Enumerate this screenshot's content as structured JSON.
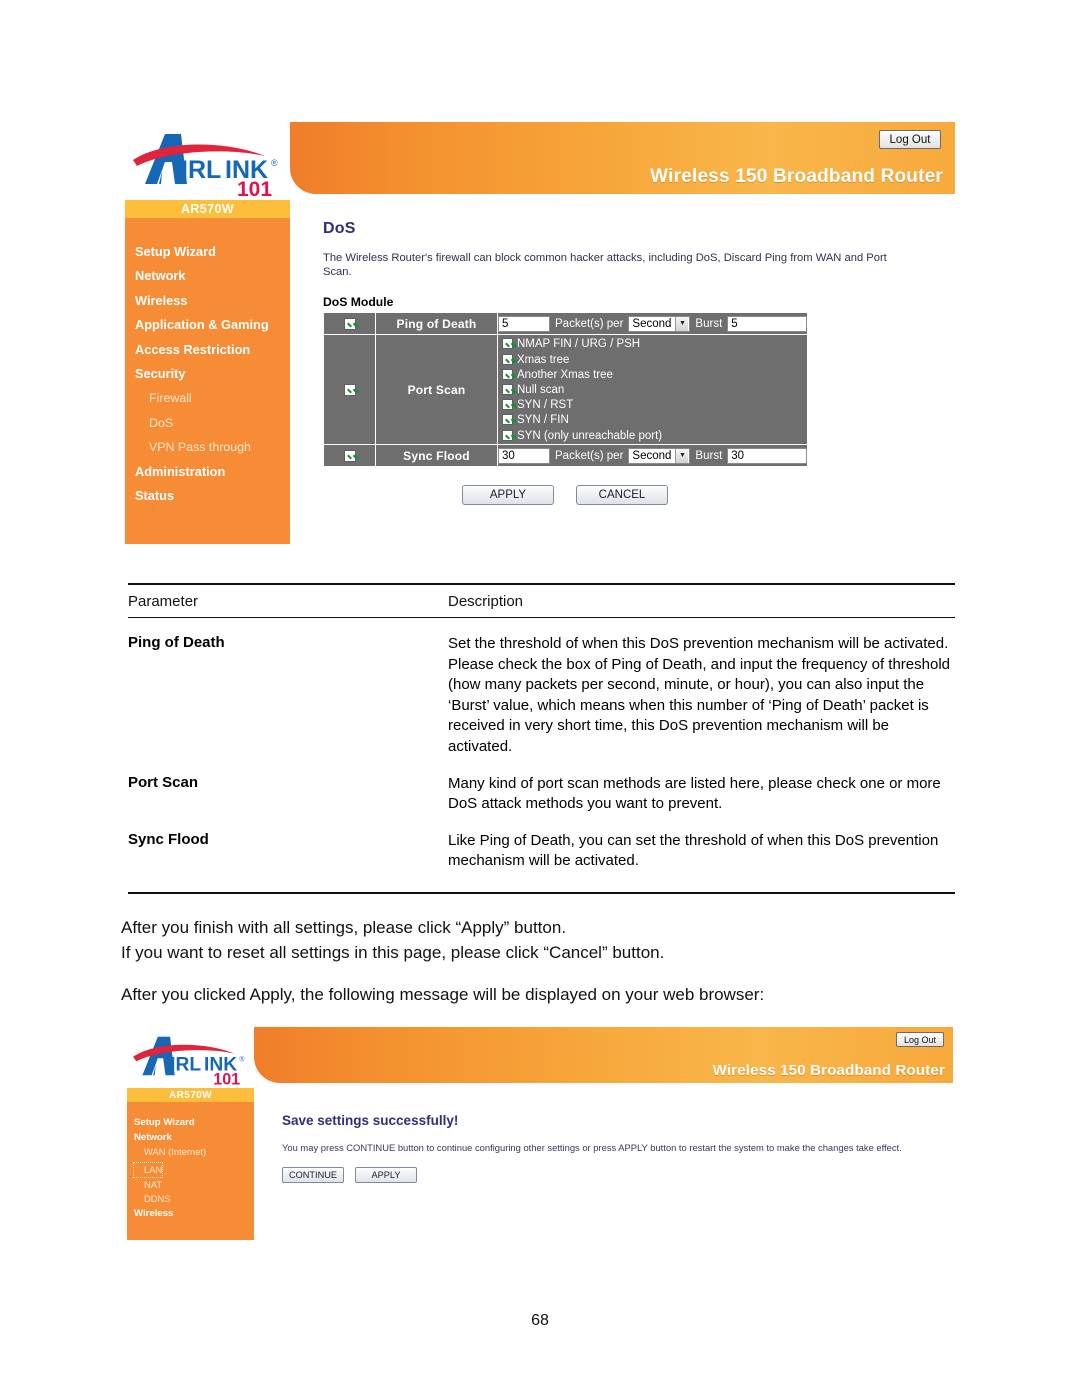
{
  "page": {
    "number": "68"
  },
  "dos_screenshot": {
    "brand": {
      "name": "AIRLINK",
      "suffix": "101"
    },
    "model": "AR570W",
    "header_title": "Wireless 150 Broadband Router",
    "logout_label": "Log Out",
    "nav": [
      {
        "label": "Setup Wizard",
        "level": "top"
      },
      {
        "label": "Network",
        "level": "top"
      },
      {
        "label": "Wireless",
        "level": "top"
      },
      {
        "label": "Application & Gaming",
        "level": "top"
      },
      {
        "label": "Access Restriction",
        "level": "top"
      },
      {
        "label": "Security",
        "level": "top"
      },
      {
        "label": "Firewall",
        "level": "sub"
      },
      {
        "label": "DoS",
        "level": "sub"
      },
      {
        "label": "VPN Pass through",
        "level": "sub"
      },
      {
        "label": "Administration",
        "level": "top"
      },
      {
        "label": "Status",
        "level": "top"
      }
    ],
    "page_title": "DoS",
    "page_desc": "The Wireless Router's firewall can block common hacker attacks, including DoS, Discard Ping from WAN and Port Scan.",
    "module_label": "DoS Module",
    "rows": {
      "ping_of_death": {
        "name": "Ping of Death",
        "enabled": true,
        "packets": "5",
        "per_label": "Packet(s) per",
        "unit": "Second",
        "burst_label": "Burst",
        "burst": "5"
      },
      "port_scan": {
        "name": "Port Scan",
        "enabled": true,
        "methods": [
          {
            "label": "NMAP FIN / URG / PSH",
            "checked": true
          },
          {
            "label": "Xmas tree",
            "checked": true
          },
          {
            "label": "Another Xmas tree",
            "checked": true
          },
          {
            "label": "Null scan",
            "checked": true
          },
          {
            "label": "SYN / RST",
            "checked": true
          },
          {
            "label": "SYN / FIN",
            "checked": true
          },
          {
            "label": "SYN (only unreachable port)",
            "checked": true
          }
        ]
      },
      "sync_flood": {
        "name": "Sync Flood",
        "enabled": true,
        "packets": "30",
        "per_label": "Packet(s) per",
        "unit": "Second",
        "burst_label": "Burst",
        "burst": "30"
      }
    },
    "apply_label": "APPLY",
    "cancel_label": "CANCEL"
  },
  "param_table": {
    "header": {
      "parameter": "Parameter",
      "description": "Description"
    },
    "rows": [
      {
        "parameter": "Ping of Death",
        "description": "Set the threshold of when this DoS prevention mechanism will be activated. Please check the box of Ping of Death, and input the frequency of threshold (how many packets per second, minute, or hour), you can also input the ‘Burst’ value, which means when this number of ‘Ping of Death’ packet is received in very short time, this DoS prevention mechanism will be activated."
      },
      {
        "parameter": "Port Scan",
        "description": "Many kind of port scan methods are listed here, please check one or more DoS attack methods you want to prevent."
      },
      {
        "parameter": "Sync Flood",
        "description": "Like Ping of Death, you can set the threshold of when this DoS prevention mechanism will be activated."
      }
    ]
  },
  "prose": {
    "line1": "After you finish with all settings, please click “Apply” button.",
    "line2": "If you want to reset all settings in this page, please click “Cancel” button.",
    "line3": "After you clicked Apply, the following message will be displayed on your web browser:"
  },
  "save_screenshot": {
    "brand": {
      "name": "AIRLINK",
      "suffix": "101"
    },
    "model": "AR570W",
    "header_title": "Wireless 150 Broadband Router",
    "logout_label": "Log Out",
    "nav": [
      {
        "label": "Setup Wizard",
        "level": "top"
      },
      {
        "label": "Network",
        "level": "top"
      },
      {
        "label": "WAN (Internet)",
        "level": "sub"
      },
      {
        "label": "LAN",
        "level": "sub"
      },
      {
        "label": "NAT",
        "level": "sub"
      },
      {
        "label": "DDNS",
        "level": "sub"
      },
      {
        "label": "Wireless",
        "level": "top"
      }
    ],
    "title": "Save settings successfully!",
    "message": "You may press CONTINUE button to continue configuring other settings or press APPLY button to restart the system to make the changes take effect.",
    "continue_label": "CONTINUE",
    "apply_label": "APPLY"
  }
}
